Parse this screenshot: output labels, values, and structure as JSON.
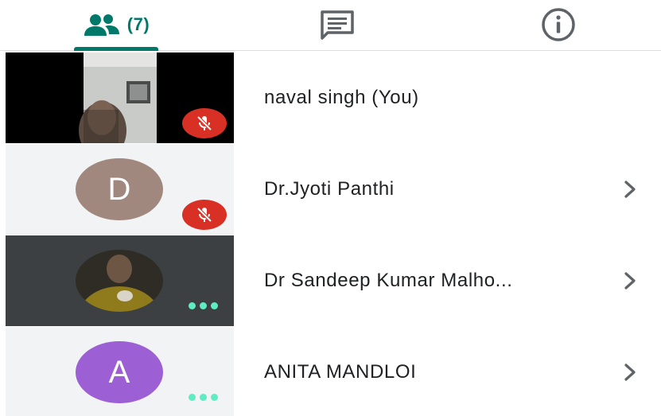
{
  "tabs": {
    "people_count": "(7)",
    "active": "people",
    "items": [
      {
        "id": "people",
        "icon": "people-icon"
      },
      {
        "id": "chat",
        "icon": "chat-message-icon"
      },
      {
        "id": "info",
        "icon": "info-icon"
      }
    ]
  },
  "colors": {
    "accent": "#00796b",
    "mute_badge": "#d93025",
    "avatar_d": "#a1887f",
    "avatar_a": "#9c5fd4",
    "more_dots": "#5eecc2"
  },
  "participants": [
    {
      "name": "naval singh (You)",
      "tile": "video",
      "status": "muted",
      "has_chevron": false
    },
    {
      "name": "Dr.Jyoti Panthi",
      "tile": "avatar",
      "avatar_letter": "D",
      "status": "muted",
      "has_chevron": true
    },
    {
      "name": "Dr Sandeep Kumar Malho...",
      "tile": "photo",
      "status": "more",
      "has_chevron": true
    },
    {
      "name": "ANITA MANDLOI",
      "tile": "avatar",
      "avatar_letter": "A",
      "status": "more",
      "has_chevron": true
    }
  ]
}
